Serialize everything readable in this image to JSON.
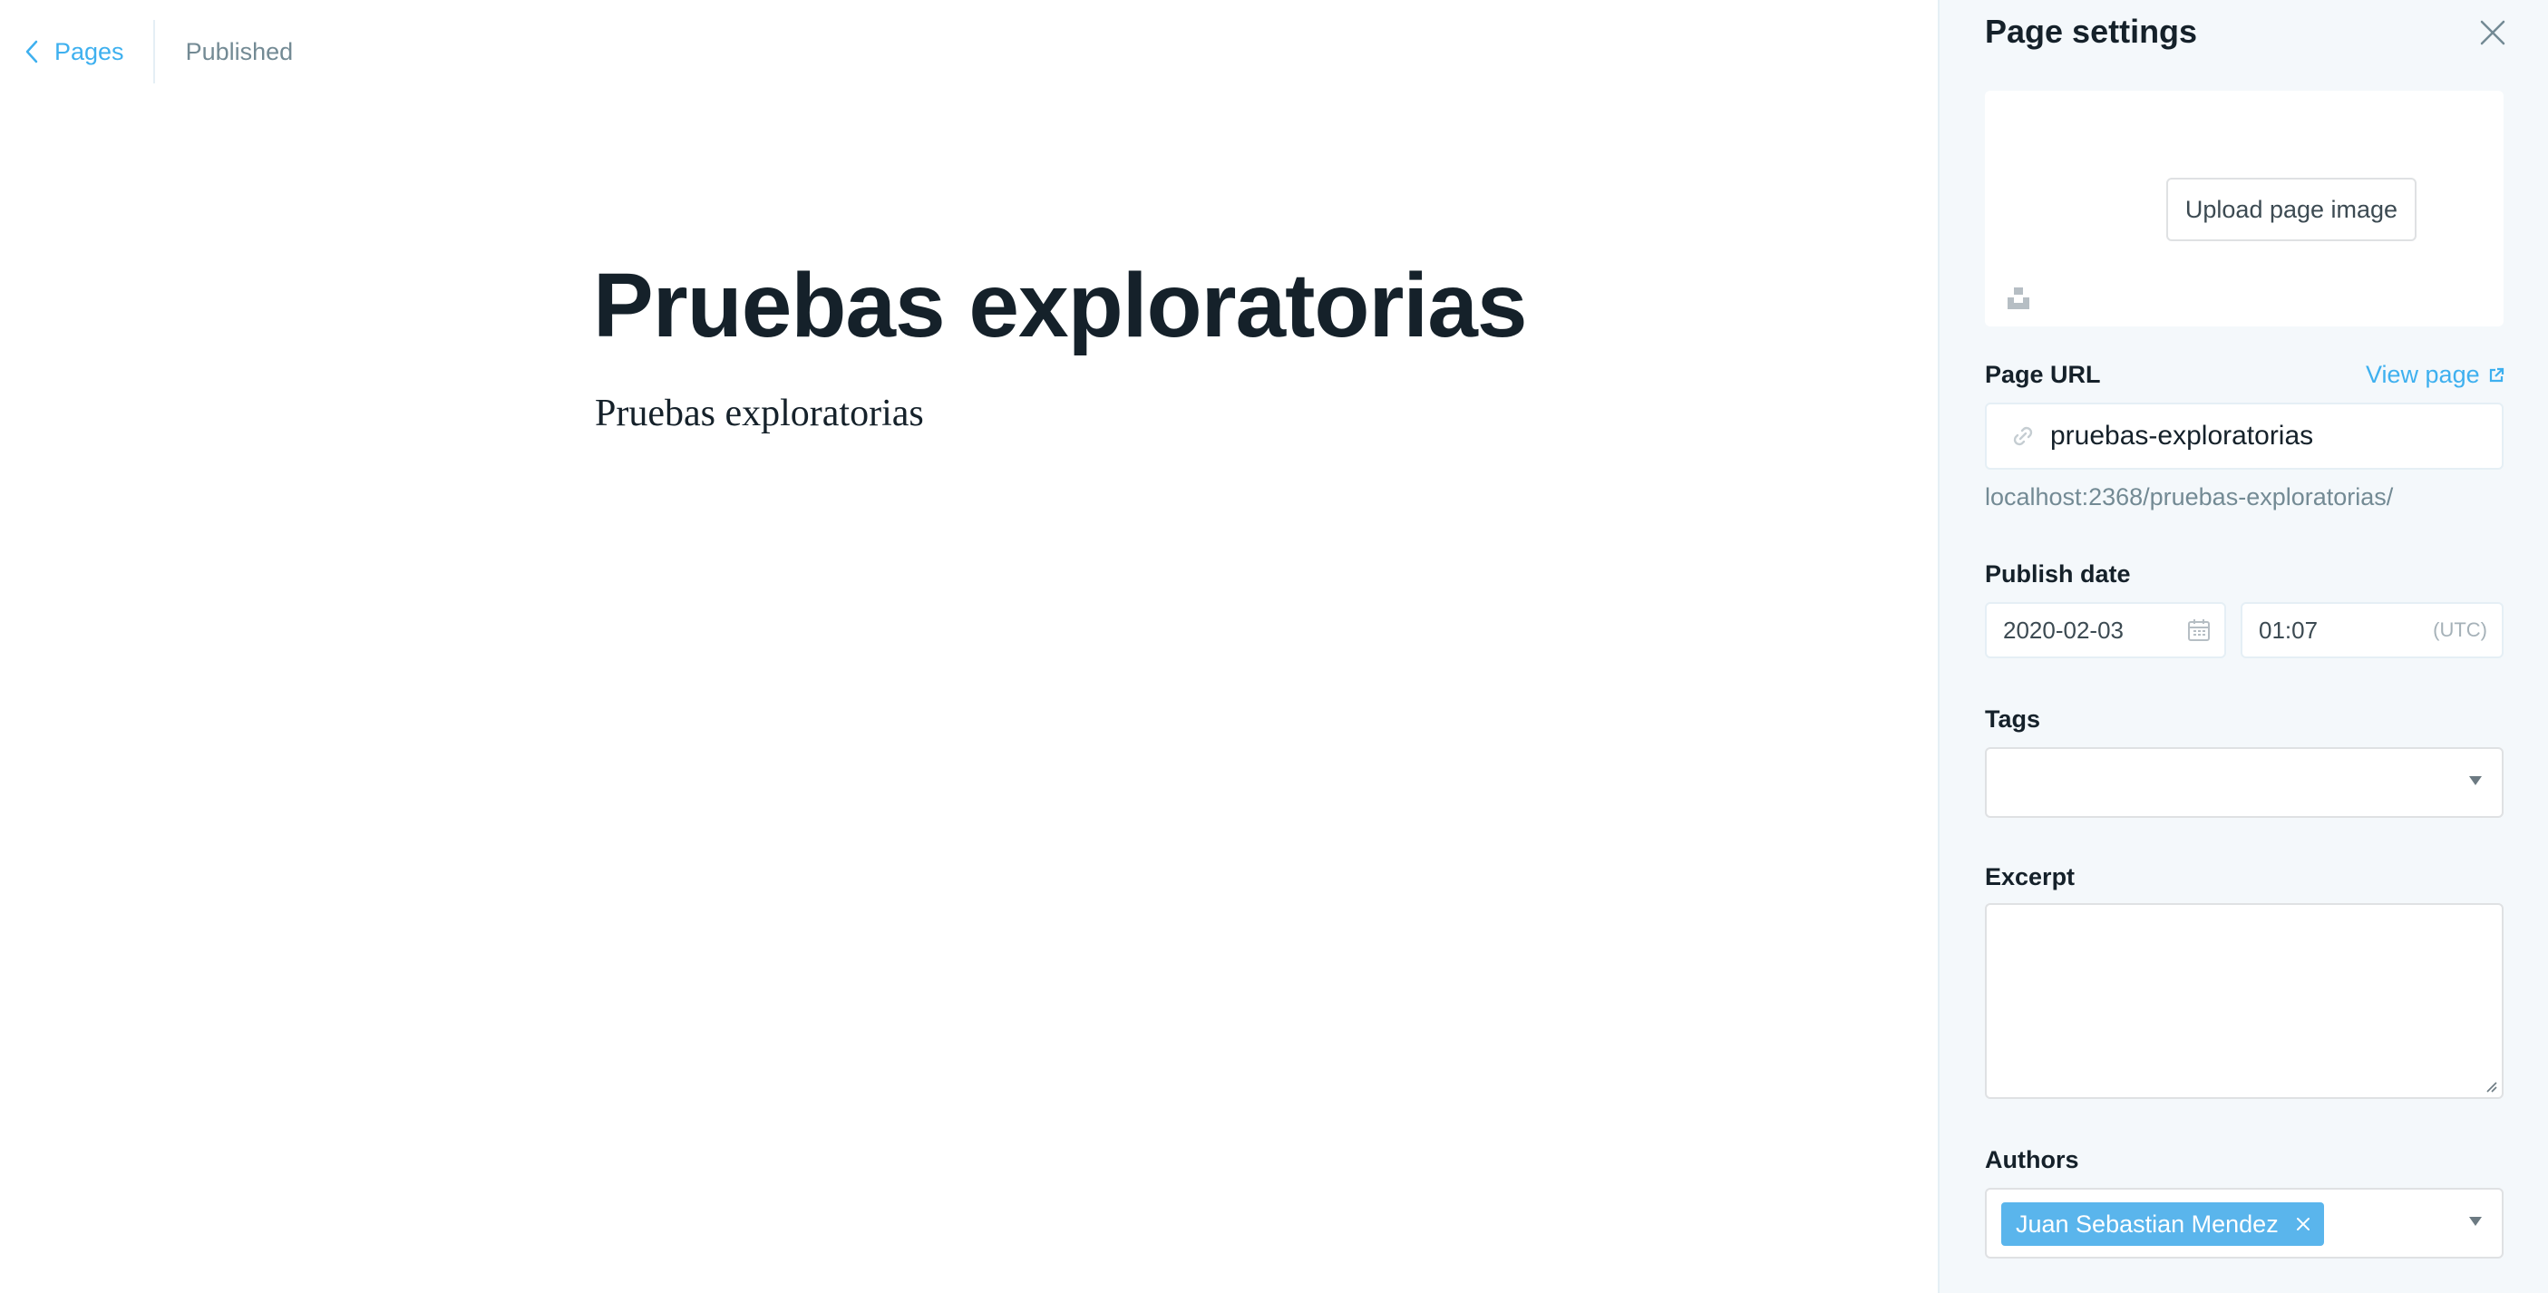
{
  "header": {
    "back_label": "Pages",
    "status": "Published"
  },
  "editor": {
    "title": "Pruebas exploratorias",
    "body": "Pruebas exploratorias"
  },
  "settings": {
    "title": "Page settings",
    "upload_label": "Upload page image",
    "url_label": "Page URL",
    "view_page_label": "View page",
    "url_value": "pruebas-exploratorias",
    "url_hint": "localhost:2368/pruebas-exploratorias/",
    "publish_date_label": "Publish date",
    "date_value": "2020-02-03",
    "time_value": "01:07",
    "timezone": "(UTC)",
    "tags_label": "Tags",
    "excerpt_label": "Excerpt",
    "authors_label": "Authors",
    "authors": [
      "Juan Sebastian Mendez"
    ]
  },
  "colors": {
    "accent": "#3eb0ef",
    "chip": "#5ab5ec",
    "panel_bg": "#f4f8fb"
  },
  "icons": [
    "chevron-left-icon",
    "close-icon",
    "unsplash-icon",
    "external-link-icon",
    "link-icon",
    "calendar-icon",
    "caret-down-icon"
  ]
}
